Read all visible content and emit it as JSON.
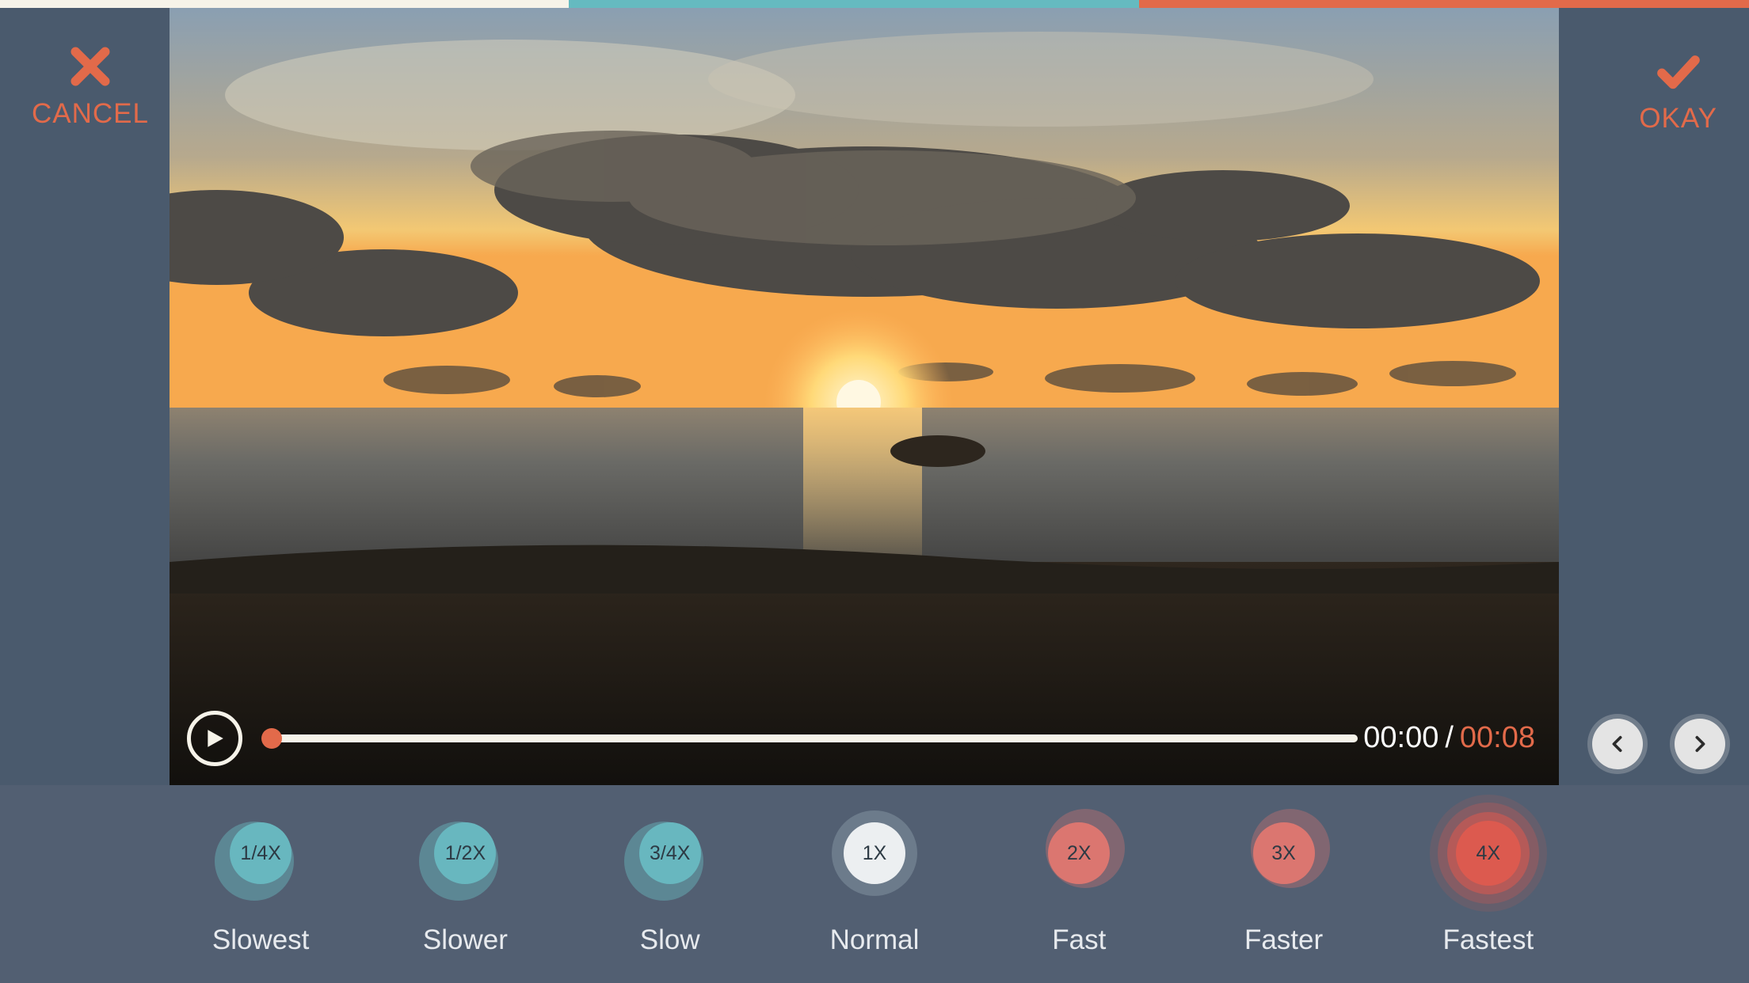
{
  "actions": {
    "cancel": "CANCEL",
    "okay": "OKAY"
  },
  "playback": {
    "current": "00:00",
    "separator": "/",
    "total": "00:08"
  },
  "speeds": [
    {
      "value": "1/4X",
      "label": "Slowest",
      "tone": "teal"
    },
    {
      "value": "1/2X",
      "label": "Slower",
      "tone": "teal"
    },
    {
      "value": "3/4X",
      "label": "Slow",
      "tone": "teal"
    },
    {
      "value": "1X",
      "label": "Normal",
      "tone": "white"
    },
    {
      "value": "2X",
      "label": "Fast",
      "tone": "red"
    },
    {
      "value": "3X",
      "label": "Faster",
      "tone": "red"
    },
    {
      "value": "4X",
      "label": "Fastest",
      "tone": "fastest"
    }
  ],
  "colors": {
    "accent": "#e26a4a",
    "teal": "#68b7bf",
    "panel": "#4a5a6d"
  }
}
